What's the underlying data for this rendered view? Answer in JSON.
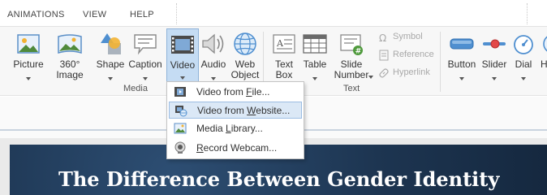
{
  "tabs": [
    {
      "label": "ANIMATIONS"
    },
    {
      "label": "VIEW"
    },
    {
      "label": "HELP"
    }
  ],
  "ribbon": {
    "buttons": [
      {
        "id": "picture",
        "label": "Picture",
        "icon": "picture-icon"
      },
      {
        "id": "image360",
        "label": "360° Image",
        "icon": "panorama-icon"
      },
      {
        "id": "shape",
        "label": "Shape",
        "icon": "shapes-icon"
      },
      {
        "id": "caption",
        "label": "Caption",
        "icon": "caption-icon"
      },
      {
        "id": "video",
        "label": "Video",
        "icon": "film-icon",
        "selected": true
      },
      {
        "id": "audio",
        "label": "Audio",
        "icon": "speaker-icon"
      },
      {
        "id": "webobject",
        "label": "Web\nObject",
        "icon": "globe-icon"
      },
      {
        "id": "textbox",
        "label": "Text\nBox",
        "icon": "text-box-icon"
      },
      {
        "id": "table",
        "label": "Table",
        "icon": "table-icon"
      },
      {
        "id": "slidenumber",
        "label": "Slide\nNumber",
        "icon": "slide-number-icon"
      },
      {
        "id": "button",
        "label": "Button",
        "icon": "button-icon"
      },
      {
        "id": "slider",
        "label": "Slider",
        "icon": "slider-icon"
      },
      {
        "id": "dial",
        "label": "Dial",
        "icon": "dial-icon"
      },
      {
        "id": "hotspot",
        "label": "H",
        "icon": "hotspot-icon"
      }
    ],
    "small_items": [
      {
        "label": "Symbol",
        "icon": "omega-icon"
      },
      {
        "label": "Reference",
        "icon": "reference-icon"
      },
      {
        "label": "Hyperlink",
        "icon": "link-icon"
      }
    ],
    "groups": {
      "media": "Media",
      "text": "Text"
    }
  },
  "video_menu": {
    "items": [
      {
        "prefix": "Video from ",
        "accel": "F",
        "suffix": "ile...",
        "icon": "video-file-icon"
      },
      {
        "prefix": "Video from ",
        "accel": "W",
        "suffix": "ebsite...",
        "icon": "video-website-icon",
        "highlighted": true
      },
      {
        "prefix": "Media ",
        "accel": "L",
        "suffix": "ibrary...",
        "icon": "media-library-icon"
      },
      {
        "prefix": "",
        "accel": "R",
        "suffix": "ecord Webcam...",
        "icon": "webcam-icon"
      }
    ]
  },
  "slide": {
    "title": "The Difference Between Gender Identity"
  },
  "colors": {
    "accent": "#2b7cd3",
    "selected_bg": "#c5dcf3",
    "slide_bg": "#1d3551"
  }
}
